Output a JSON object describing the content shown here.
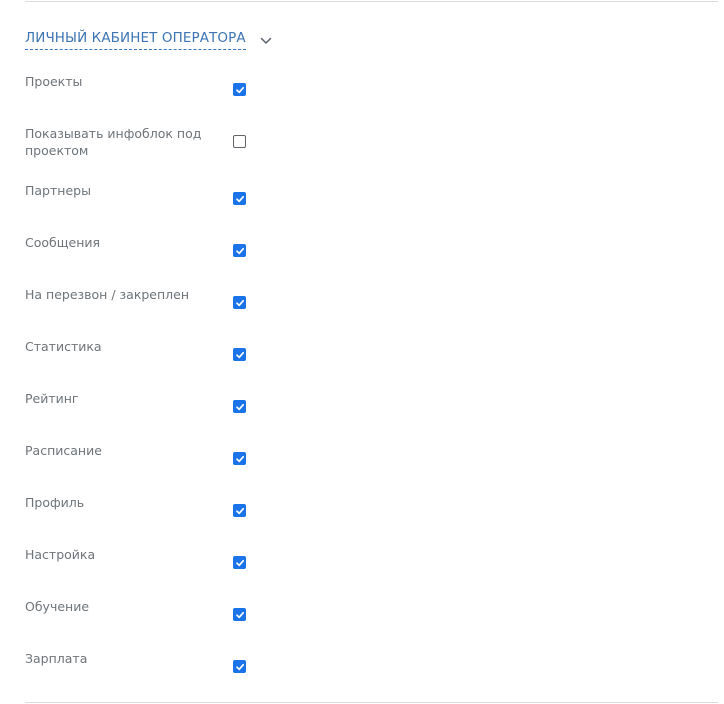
{
  "section": {
    "title": "ЛИЧНЫЙ КАБИНЕТ ОПЕРАТОРА",
    "toggle_icon": "chevron-down-icon",
    "accent_color": "#3d74b4"
  },
  "checkbox_color": "#1a73e8",
  "settings": [
    {
      "label": "Проекты",
      "checked": true
    },
    {
      "label": "Показывать инфоблок под проектом",
      "checked": false
    },
    {
      "label": "Партнеры",
      "checked": true
    },
    {
      "label": "Сообщения",
      "checked": true
    },
    {
      "label": "На перезвон / закреплен",
      "checked": true
    },
    {
      "label": "Статистика",
      "checked": true
    },
    {
      "label": "Рейтинг",
      "checked": true
    },
    {
      "label": "Расписание",
      "checked": true
    },
    {
      "label": "Профиль",
      "checked": true
    },
    {
      "label": "Настройка",
      "checked": true
    },
    {
      "label": "Обучение",
      "checked": true
    },
    {
      "label": "Зарплата",
      "checked": true
    }
  ]
}
